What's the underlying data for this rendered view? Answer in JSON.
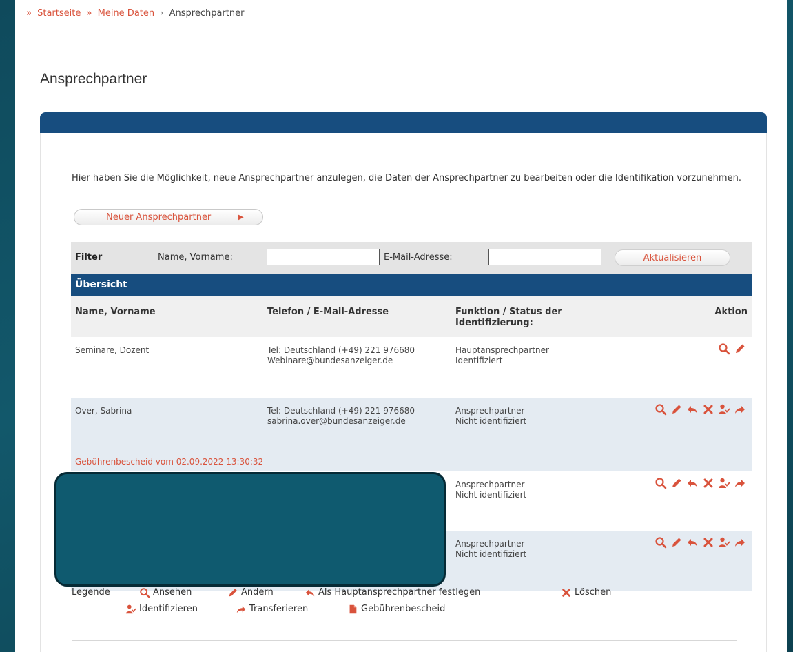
{
  "breadcrumb": {
    "prefix": "»",
    "home": "Startseite",
    "sep1": "»",
    "mydata": "Meine Daten",
    "sep2": "›",
    "current": "Ansprechpartner"
  },
  "page_title": "Ansprechpartner",
  "intro_text": "Hier haben Sie die Möglichkeit, neue Ansprechpartner anzulegen, die Daten der Ansprechpartner zu bearbeiten oder die Identifikation vorzunehmen.",
  "new_button": {
    "label": "Neuer Ansprechpartner",
    "arrow": "▶"
  },
  "filter": {
    "title": "Filter",
    "name_label": "Name, Vorname:",
    "name_value": "",
    "email_label": "E-Mail-Adresse:",
    "email_value": "",
    "update_label": "Aktualisieren"
  },
  "overview_title": "Übersicht",
  "columns": {
    "name": "Name, Vorname",
    "contact": "Telefon / E-Mail-Adresse",
    "function": "Funktion / Status der Identifizierung:",
    "action": "Aktion"
  },
  "rows": [
    {
      "name": "Seminare, Dozent",
      "phone": "Tel: Deutschland (+49) 221 976680",
      "email": "Webinare@bundesanzeiger.de",
      "role": "Hauptansprechpartner",
      "status": "Identifiziert",
      "fee": ""
    },
    {
      "name": "Over, Sabrina",
      "phone": "Tel: Deutschland (+49) 221 976680",
      "email": "sabrina.over@bundesanzeiger.de",
      "role": "Ansprechpartner",
      "status": "Nicht identifiziert",
      "fee": "Gebührenbescheid vom 02.09.2022 13:30:32"
    },
    {
      "name": "",
      "phone": "",
      "email": "",
      "role": "Ansprechpartner",
      "status": "Nicht identifiziert",
      "fee": ""
    },
    {
      "name": "",
      "phone": "",
      "email": "",
      "role": "Ansprechpartner",
      "status": "Nicht identifiziert",
      "fee": ""
    }
  ],
  "legend": {
    "title": "Legende",
    "view": "Ansehen",
    "edit": "Ändern",
    "set_main": "Als Hauptansprechpartner festlegen",
    "delete": "Löschen",
    "identify": "Identifizieren",
    "transfer": "Transferieren",
    "fee": "Gebührenbescheid"
  },
  "icons": {
    "view": "magnifier-icon",
    "edit": "pencil-icon",
    "set_main": "reply-arrow-icon",
    "delete": "x-icon",
    "identify": "user-check-icon",
    "transfer": "forward-arrow-icon",
    "fee": "document-icon"
  },
  "colors": {
    "accent": "#d9533c",
    "header_blue": "#174d7f",
    "row_alt": "#e4ebf2",
    "background": "#12586b",
    "redaction": "#0f5a6f"
  }
}
